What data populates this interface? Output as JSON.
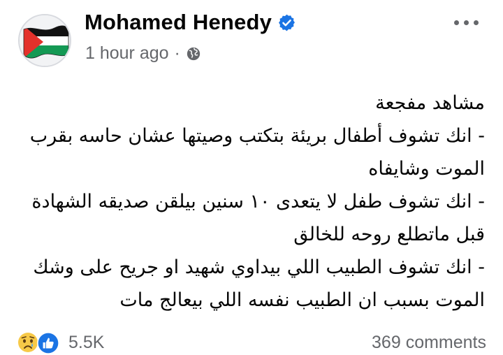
{
  "post": {
    "author": "Mohamed Henedy",
    "time": "1 hour ago",
    "separator": "·",
    "lines": [
      "مشاهد مفجعة",
      "- انك تشوف أطفال بريئة بتكتب وصيتها عشان حاسه بقرب",
      "الموت وشايفاه",
      "- انك تشوف طفل لا يتعدى ١٠ سنين بيلقن صديقه الشهادة",
      "قبل ماتطلع روحه للخالق",
      "- انك تشوف الطبيب اللي بيداوي شهيد او جريح على وشك",
      "الموت بسبب ان الطبيب نفسه اللي بيعالج مات"
    ]
  },
  "footer": {
    "reaction_count": "5.5K",
    "comments": "369 comments"
  },
  "icons": {
    "avatar": "palestine-flag-avatar",
    "verified": "verified-badge-icon",
    "audience": "globe-icon",
    "more": "more-options-icon",
    "reactions": [
      "sad-reaction-icon",
      "like-reaction-icon"
    ]
  },
  "colors": {
    "verified_blue": "#1b74e4",
    "secondary_text": "#65676b"
  }
}
